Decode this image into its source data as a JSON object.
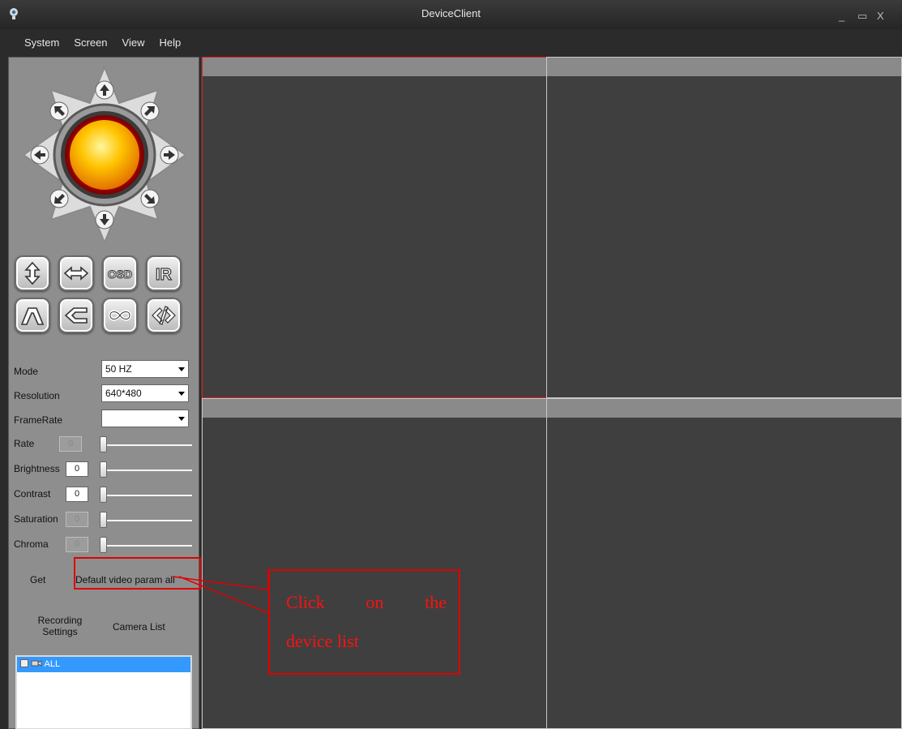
{
  "window": {
    "title": "DeviceClient",
    "minimize": "_",
    "maximize": "▭",
    "close": "X"
  },
  "menu": [
    "System",
    "Screen",
    "View",
    "Help"
  ],
  "tools": [
    {
      "name": "flip-vertical-button",
      "icon": "vertical-arrows-icon"
    },
    {
      "name": "flip-horizontal-button",
      "icon": "horizontal-arrows-icon"
    },
    {
      "name": "osd-button",
      "icon": "osd-icon",
      "label": "OSD"
    },
    {
      "name": "ir-button",
      "icon": "ir-icon",
      "label": "IR"
    },
    {
      "name": "tilt-button",
      "icon": "tilt-icon"
    },
    {
      "name": "zoom-button",
      "icon": "wedge-icon"
    },
    {
      "name": "loop-button",
      "icon": "infinity-icon"
    },
    {
      "name": "code-button",
      "icon": "code-icon"
    }
  ],
  "params": {
    "mode": {
      "label": "Mode",
      "value": "50 HZ"
    },
    "resolution": {
      "label": "Resolution",
      "value": "640*480"
    },
    "framerate": {
      "label": "FrameRate",
      "value": ""
    },
    "sliders": [
      {
        "label": "Rate",
        "value": "0",
        "enabled": false
      },
      {
        "label": "Brightness",
        "value": "0",
        "enabled": true
      },
      {
        "label": "Contrast",
        "value": "0",
        "enabled": true
      },
      {
        "label": "Saturation",
        "value": "0",
        "enabled": false
      },
      {
        "label": "Chroma",
        "value": "0",
        "enabled": false
      }
    ]
  },
  "actions": {
    "get": "Get",
    "default": "Default video param all",
    "recording_line1": "Recording",
    "recording_line2": "Settings",
    "camera_list": "Camera List"
  },
  "device_list": {
    "items": [
      "ALL"
    ]
  },
  "annotation": {
    "callout_words": [
      "Click",
      "on",
      "the"
    ],
    "callout_line2": "device list",
    "color": "#e00000"
  },
  "colors": {
    "selected_cell": "#e02020",
    "list_highlight": "#3399ff",
    "ptz_center": "#ffc400"
  }
}
